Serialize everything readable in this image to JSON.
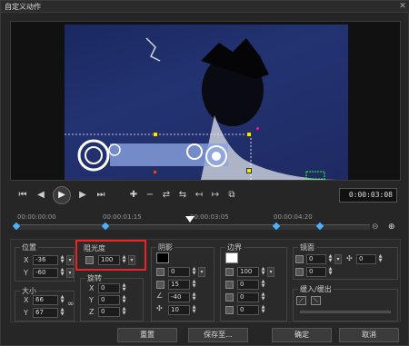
{
  "window": {
    "title": "自定义动作"
  },
  "timeline": {
    "timecode": "0:00:03:08",
    "ticks": [
      "00:00:00:00",
      "00:00:01:15",
      "00:00:03:05",
      "00:00:04:20"
    ]
  },
  "position": {
    "label": "位置",
    "x_label": "X",
    "y_label": "Y",
    "x": "-36",
    "y": "-60"
  },
  "size": {
    "label": "大小",
    "x_label": "X",
    "y_label": "Y",
    "x": "66",
    "y": "67"
  },
  "opacity": {
    "label": "阻光度",
    "value": "100"
  },
  "rotation": {
    "label": "旋转",
    "x_label": "X",
    "y_label": "Y",
    "z_label": "Z",
    "x": "0",
    "y": "0",
    "z": "0"
  },
  "shadow": {
    "label": "阴影",
    "v1": "0",
    "v2": "15",
    "v3": "-40",
    "v4": "10"
  },
  "border": {
    "label": "边界",
    "v1": "100",
    "v2": "0",
    "v3": "0",
    "v4": "0"
  },
  "mirror": {
    "label": "镜面",
    "v1": "0",
    "v2": "0",
    "v3": "0"
  },
  "fade": {
    "label": "缓入/缓出"
  },
  "buttons": {
    "reset": "重置",
    "save": "保存至...",
    "ok": "确定",
    "cancel": "取消"
  },
  "colors": {
    "accent": "#ffe600",
    "keyframe": "#4ab0ff",
    "highlight": "#ee2222"
  }
}
